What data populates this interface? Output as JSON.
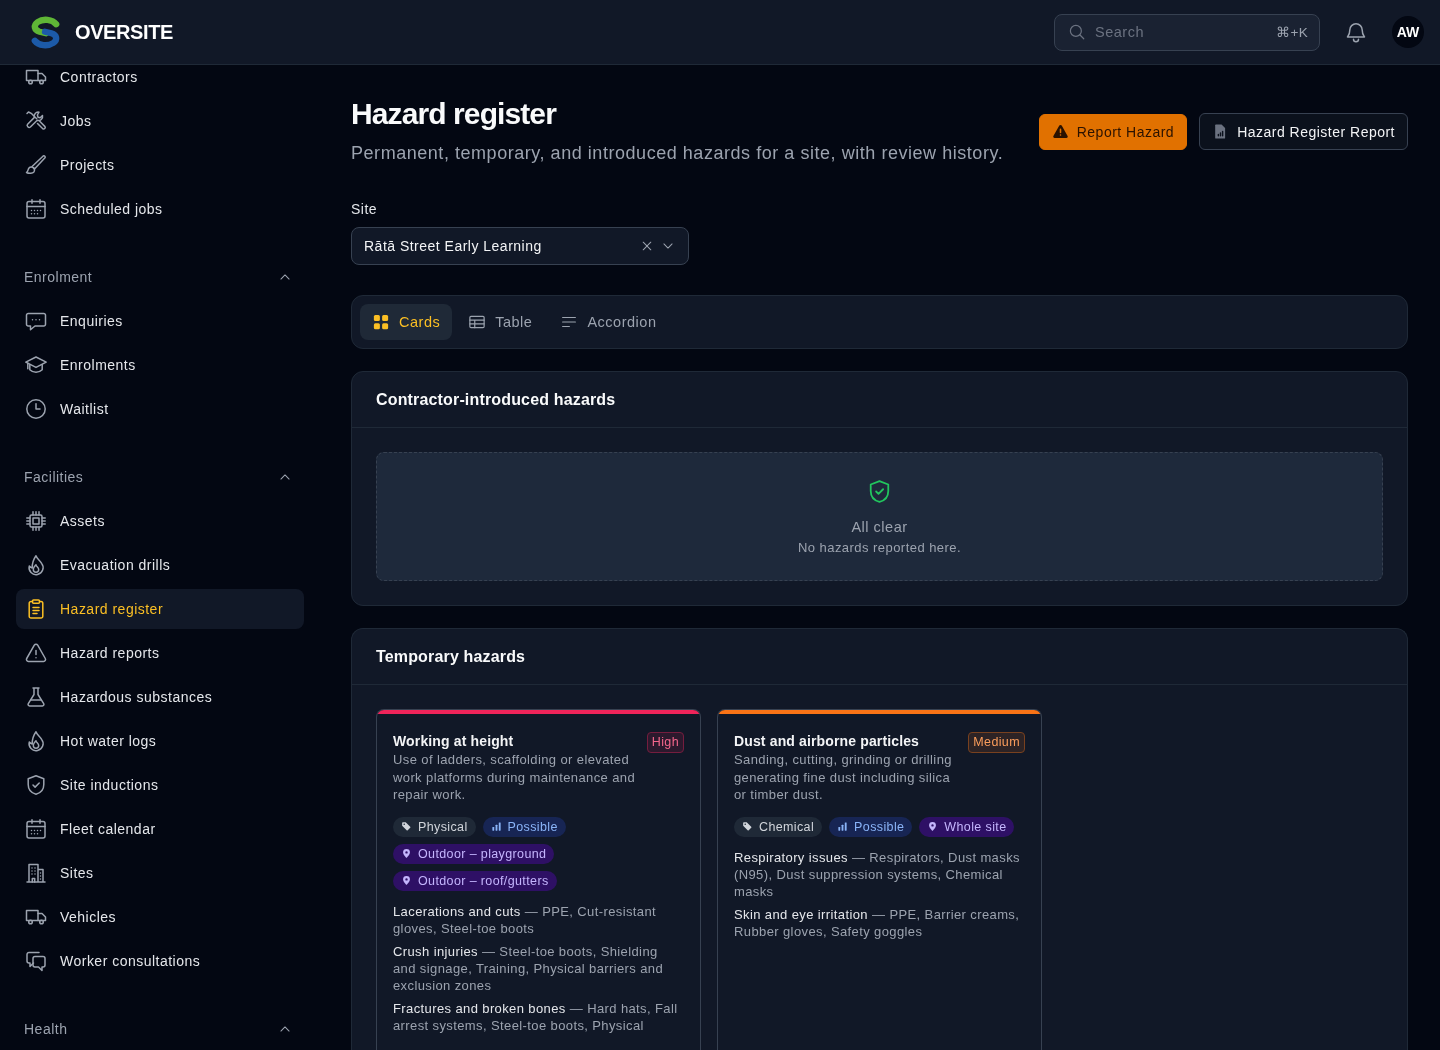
{
  "header": {
    "brand": "OVERSITE",
    "search": {
      "placeholder": "Search",
      "shortcut": "⌘+K"
    },
    "avatar": "AW"
  },
  "sidebar": {
    "groups": [
      {
        "items": [
          {
            "label": "Contractors",
            "selected": false
          },
          {
            "label": "Jobs",
            "selected": false
          },
          {
            "label": "Projects",
            "selected": false
          },
          {
            "label": "Scheduled jobs",
            "selected": false
          }
        ]
      },
      {
        "title": "Enrolment",
        "expanded": true,
        "items": [
          {
            "label": "Enquiries",
            "selected": false
          },
          {
            "label": "Enrolments",
            "selected": false
          },
          {
            "label": "Waitlist",
            "selected": false
          }
        ]
      },
      {
        "title": "Facilities",
        "expanded": true,
        "items": [
          {
            "label": "Assets",
            "selected": false
          },
          {
            "label": "Evacuation drills",
            "selected": false
          },
          {
            "label": "Hazard register",
            "selected": true
          },
          {
            "label": "Hazard reports",
            "selected": false
          },
          {
            "label": "Hazardous substances",
            "selected": false
          },
          {
            "label": "Hot water logs",
            "selected": false
          },
          {
            "label": "Site inductions",
            "selected": false
          },
          {
            "label": "Fleet calendar",
            "selected": false
          },
          {
            "label": "Sites",
            "selected": false
          },
          {
            "label": "Vehicles",
            "selected": false
          },
          {
            "label": "Worker consultations",
            "selected": false
          }
        ]
      },
      {
        "title": "Health",
        "expanded": true
      }
    ]
  },
  "page": {
    "title": "Hazard register",
    "subtitle": "Permanent, temporary, and introduced hazards for a site, with review history.",
    "actions": [
      {
        "label": "Report Hazard",
        "kind": "primary"
      },
      {
        "label": "Hazard Register Report",
        "kind": "secondary"
      }
    ]
  },
  "site_filter": {
    "label": "Site",
    "value": "Rātā Street Early Learning"
  },
  "view_tabs": [
    {
      "label": "Cards",
      "selected": true
    },
    {
      "label": "Table",
      "selected": false
    },
    {
      "label": "Accordion",
      "selected": false
    }
  ],
  "sections": [
    {
      "title": "Contractor-introduced hazards",
      "empty_state": {
        "title": "All clear",
        "message": "No hazards reported here."
      }
    },
    {
      "title": "Temporary hazards",
      "cards": [
        {
          "title": "Working at height",
          "severity": "High",
          "color": "#f0245a",
          "description": "Use of ladders, scaffolding or elevated work platforms during maintenance and repair work.",
          "tags": [
            {
              "kind": "category",
              "label": "Physical"
            },
            {
              "kind": "likelihood",
              "label": "Possible"
            },
            {
              "kind": "location",
              "label": "Outdoor – playground"
            },
            {
              "kind": "location",
              "label": "Outdoor – roof/gutters"
            }
          ],
          "consequences": [
            "**Lacerations and cuts** — PPE, Cut-resistant gloves, Steel-toe boots",
            "**Crush injuries** — Steel-toe boots, Shielding and signage, Training, Physical barriers and exclusion zones",
            "**Fractures and broken bones** — Hard hats, Fall arrest systems, Steel-toe boots, Physical"
          ]
        },
        {
          "title": "Dust and airborne particles",
          "severity": "Medium",
          "color": "#f97316",
          "description": "Sanding, cutting, grinding or drilling generating fine dust including silica or timber dust.",
          "tags": [
            {
              "kind": "category",
              "label": "Chemical"
            },
            {
              "kind": "likelihood",
              "label": "Possible"
            },
            {
              "kind": "location",
              "label": "Whole site"
            }
          ],
          "consequences": [
            "**Respiratory issues** — Respirators, Dust masks (N95), Dust suppression systems, Chemical masks",
            "**Skin and eye irritation** — PPE, Barrier creams, Rubber gloves, Safety goggles"
          ]
        }
      ]
    }
  ]
}
